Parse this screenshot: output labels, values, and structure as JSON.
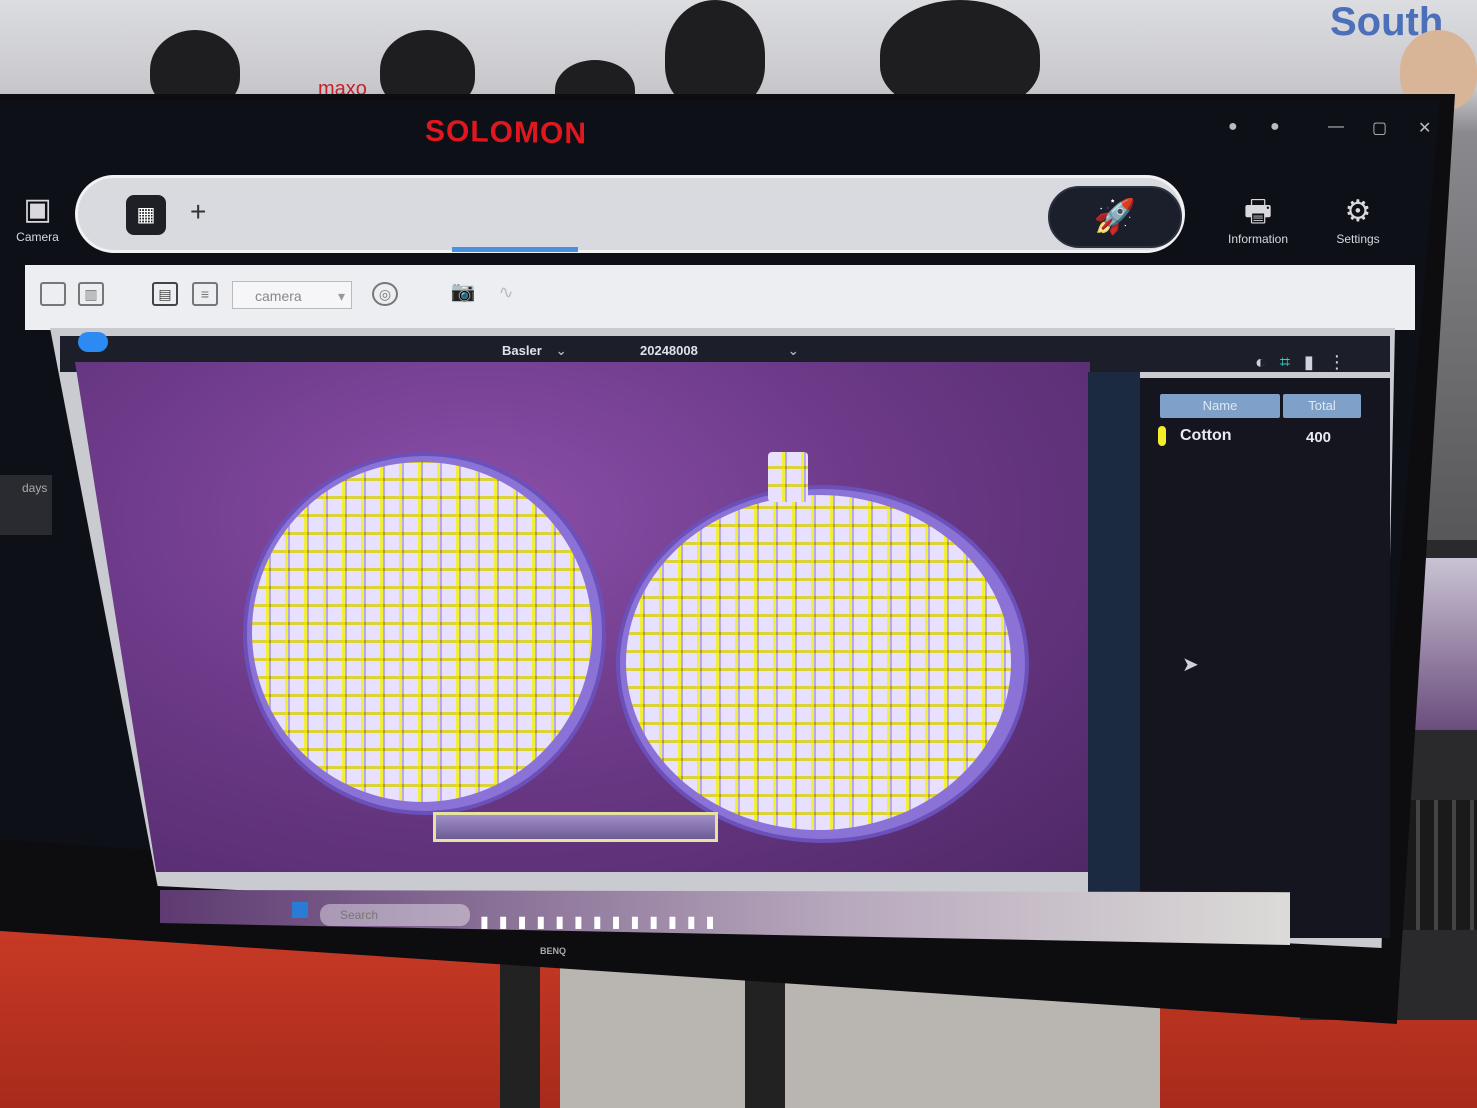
{
  "background": {
    "booth_sign": "South",
    "crowd_sign": "maxo"
  },
  "app": {
    "brand": "SOLOMON",
    "window_controls": [
      "●",
      "●",
      "—",
      "▢",
      "✕"
    ],
    "left_nav": {
      "camera_label": "Camera",
      "days_label": "days"
    },
    "command_bar": {
      "tab_icon": "camera-tab-icon",
      "add_icon": "plus-icon",
      "run_icon": "rocket-icon"
    },
    "right_nav": {
      "information_label": "Information",
      "settings_label": "Settings"
    },
    "toolbar": {
      "camera_select_value": "camera",
      "camera_select_arrow": "▾"
    },
    "viewer": {
      "camera_vendor": "Basler",
      "camera_serial": "20248008",
      "top_right_icons": [
        "◐",
        "⌗",
        "▮",
        "⋮"
      ]
    },
    "results": {
      "columns": [
        "Name",
        "Total"
      ],
      "rows": [
        {
          "name": "Cotton",
          "total": "400",
          "color": "#f5ec2a"
        }
      ]
    },
    "taskbar": {
      "search_placeholder": "Search",
      "monitor_brand": "BENQ"
    }
  },
  "colors": {
    "brand_red": "#e0171e",
    "accent_blue": "#29a6ff",
    "canvas_purple": "#6d3a89",
    "detection_yellow": "#f2ef3a"
  }
}
